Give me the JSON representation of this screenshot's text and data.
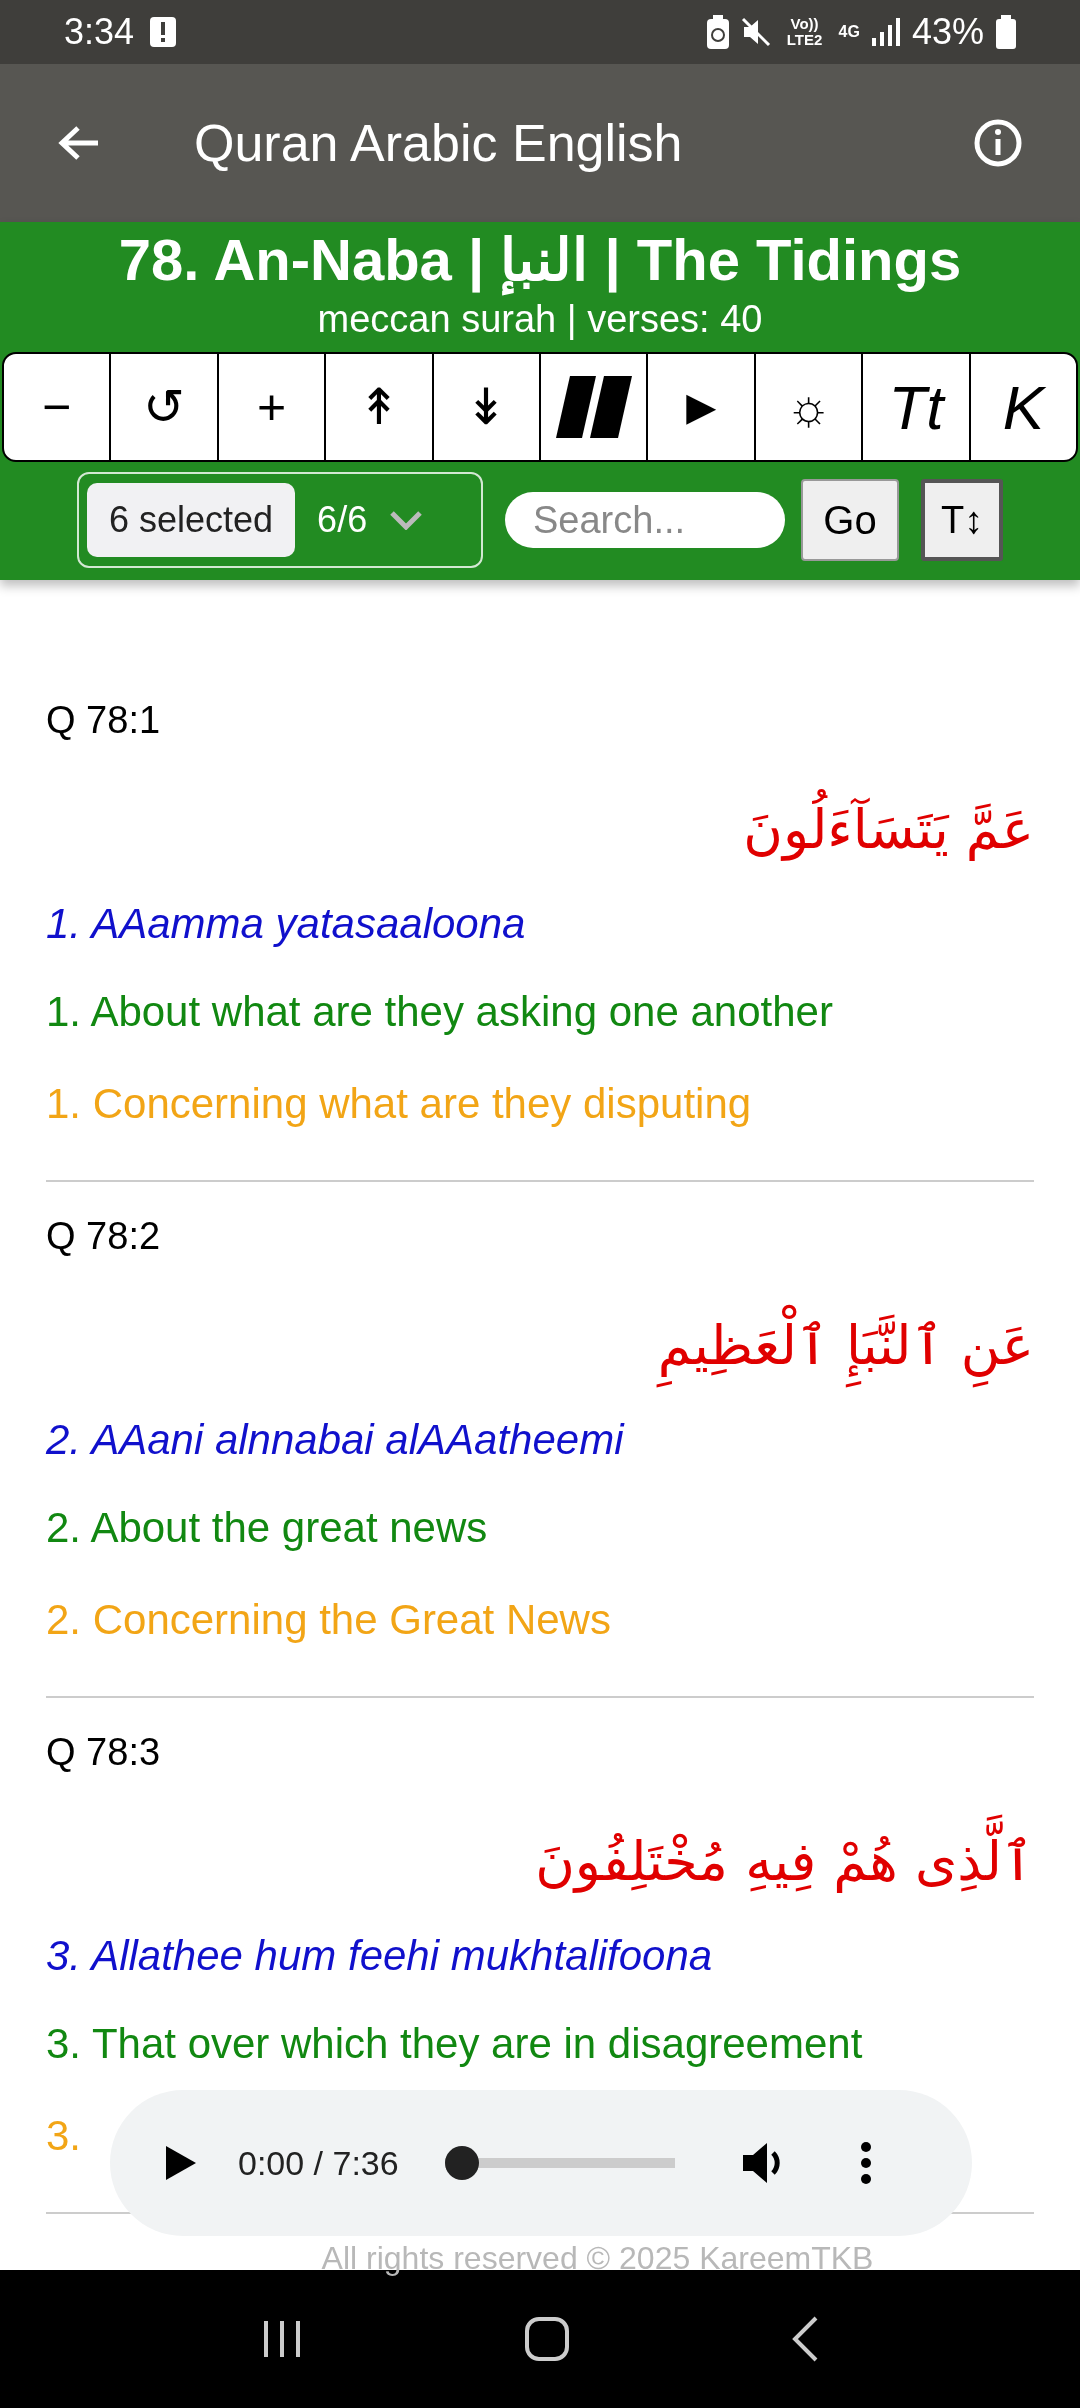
{
  "status_bar": {
    "time": "3:34",
    "network": "Vo)) LTE2",
    "data": "4G",
    "battery": "43%"
  },
  "app_bar": {
    "title": "Quran Arabic English"
  },
  "surah": {
    "title": "78. An-Naba | النبإ | The Tidings",
    "subtitle": "meccan surah | verses: 40"
  },
  "toolbar": [
    {
      "kind": "glyph",
      "label": "−"
    },
    {
      "kind": "glyph",
      "label": "↺"
    },
    {
      "kind": "glyph",
      "label": "+"
    },
    {
      "kind": "glyph",
      "label": "↟"
    },
    {
      "kind": "glyph",
      "label": "↡"
    },
    {
      "kind": "pause"
    },
    {
      "kind": "glyph",
      "label": "►"
    },
    {
      "kind": "glyph",
      "label": "☼"
    },
    {
      "kind": "italic",
      "label": "Tt"
    },
    {
      "kind": "italic",
      "label": "K"
    }
  ],
  "filter": {
    "chip": "6 selected",
    "count": "6/6"
  },
  "search": {
    "placeholder": "Search..."
  },
  "go_button": "Go",
  "size_button": "T↕",
  "verses": [
    {
      "ref": "Q 78:1",
      "arabic": "عَمَّ يَتَسَآءَلُونَ",
      "transliteration": "1. AAamma yatasaaloona",
      "translation_1": "1. About what are they asking one another",
      "translation_2": "1. Concerning what are they disputing"
    },
    {
      "ref": "Q 78:2",
      "arabic": "عَنِ ٱلنَّبَإِ ٱلْعَظِيمِ",
      "transliteration": "2. AAani alnnabai alAAatheemi",
      "translation_1": "2. About the great news",
      "translation_2": "2. Concerning the Great News"
    },
    {
      "ref": "Q 78:3",
      "arabic": "ٱلَّذِى هُمْ فِيهِ مُخْتَلِفُونَ",
      "transliteration": "3. Allathee hum feehi mukhtalifoona",
      "translation_1": "3. That over which they are in disagreement",
      "translation_2": "3."
    }
  ],
  "player": {
    "time": "0:00 / 7:36",
    "level": 0.0
  },
  "footer": "All rights reserved © 2025 KareemTKB"
}
